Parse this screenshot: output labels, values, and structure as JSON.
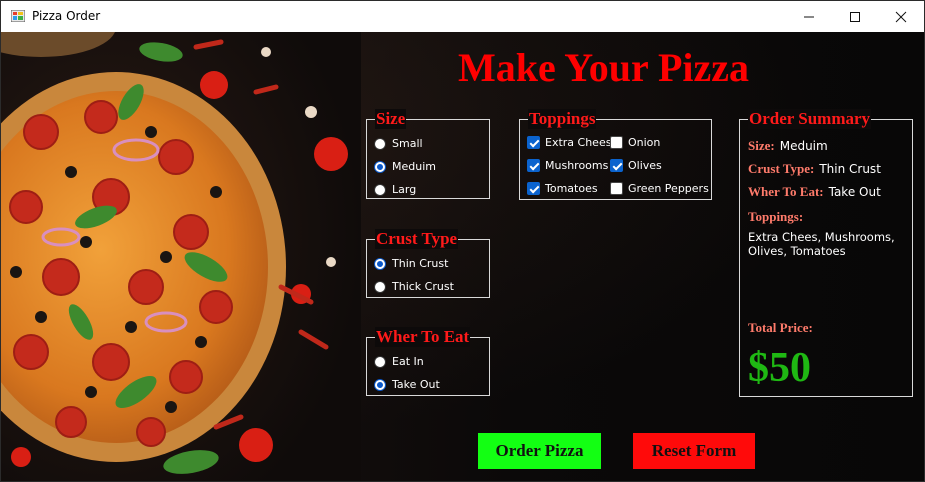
{
  "window": {
    "title": "Pizza Order",
    "icons": {
      "app": "app-icon",
      "minimize": "minimize-icon",
      "maximize": "maximize-icon",
      "close": "close-icon"
    }
  },
  "heading": "Make Your Pizza",
  "size_group": {
    "legend": "Size",
    "options": [
      {
        "label": "Small",
        "selected": false
      },
      {
        "label": "Meduim",
        "selected": true
      },
      {
        "label": "Larg",
        "selected": false
      }
    ]
  },
  "crust_group": {
    "legend": "Crust Type",
    "options": [
      {
        "label": "Thin Crust",
        "selected": true
      },
      {
        "label": "Thick Crust",
        "selected": false
      }
    ]
  },
  "eat_group": {
    "legend": "Wher To Eat",
    "options": [
      {
        "label": "Eat In",
        "selected": false
      },
      {
        "label": "Take Out",
        "selected": true
      }
    ]
  },
  "toppings_group": {
    "legend": "Toppings",
    "items": [
      {
        "label": "Extra Chees",
        "checked": true
      },
      {
        "label": "Onion",
        "checked": false
      },
      {
        "label": "Mushrooms",
        "checked": true
      },
      {
        "label": "Olives",
        "checked": true
      },
      {
        "label": "Tomatoes",
        "checked": true
      },
      {
        "label": "Green Peppers",
        "checked": false
      }
    ]
  },
  "summary": {
    "legend": "Order Summary",
    "size_label": "Size:",
    "size_value": "Meduim",
    "crust_label": "Crust Type:",
    "crust_value": "Thin Crust",
    "eat_label": "Wher To Eat:",
    "eat_value": "Take Out",
    "toppings_label": "Toppings:",
    "toppings_value": "Extra Chees, Mushrooms, Olives, Tomatoes",
    "total_label": "Total Price:",
    "total_value": "$50"
  },
  "buttons": {
    "order": "Order Pizza",
    "reset": "Reset Form"
  },
  "colors": {
    "heading": "#ff0000",
    "legend": "#ff1a1a",
    "summary_key": "#ff7b6b",
    "price": "#1fb813",
    "order_button": "#13ff13",
    "reset_button": "#ff0a0a",
    "accent": "#0b63ce"
  }
}
